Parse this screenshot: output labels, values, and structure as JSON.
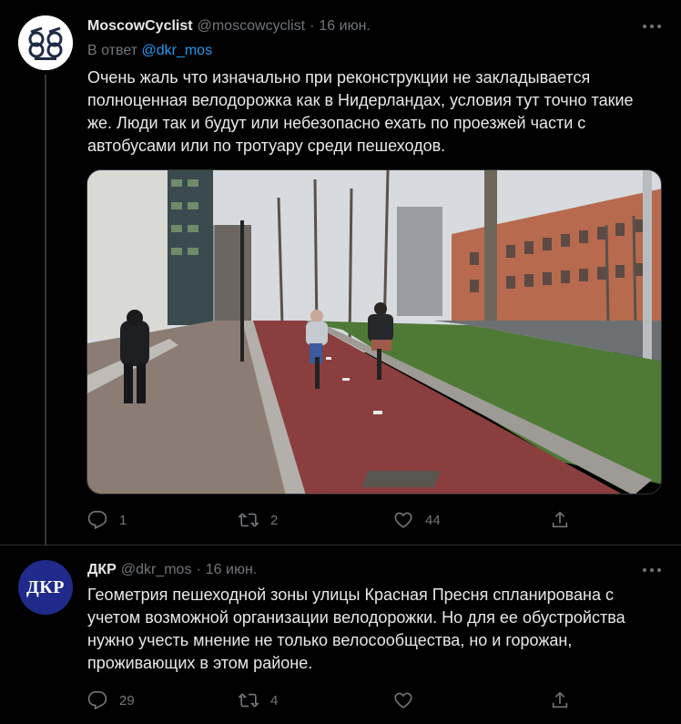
{
  "tweets": [
    {
      "name": "MoscowCyclist",
      "handle": "@moscowcyclist",
      "separator": "·",
      "date": "16 июн.",
      "reply_prefix": "В ответ",
      "reply_to": "@dkr_mos",
      "lines": [
        "Очень жаль что изначально при реконструкции не закладывается",
        "полноценная велодорожка как в Нидерландах, условия тут точно такие",
        "же. Люди так и будут или небезопасно ехать по проезжей части с",
        "автобусами или по тротуару среди пешеходов."
      ],
      "replies": "1",
      "retweets": "2",
      "likes": "44"
    },
    {
      "name": "ДКР",
      "handle": "@dkr_mos",
      "separator": "·",
      "date": "16 июн.",
      "avatar_text": "ДКР",
      "lines": [
        "Геометрия пешеходной зоны улицы Красная Пресня спланирована с",
        "учетом возможной организации велодорожки. Но для ее обустройства",
        "нужно учесть  мнение не только велосообщества, но и горожан,",
        "проживающих в этом районе."
      ],
      "replies": "29",
      "retweets": "4",
      "likes": ""
    }
  ],
  "icons": {
    "reply": "reply-icon",
    "retweet": "retweet-icon",
    "like": "heart-icon",
    "share": "share-icon",
    "more": "more-icon"
  },
  "colors": {
    "background": "#000000",
    "text": "#e7e9ea",
    "muted": "#71767b",
    "link": "#1d9bf0",
    "divider": "#2f3336"
  }
}
